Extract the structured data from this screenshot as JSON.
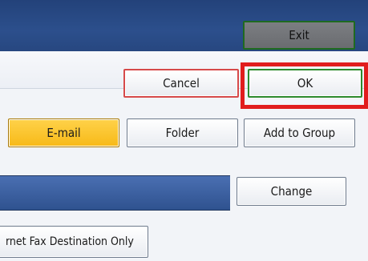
{
  "header": {
    "exit_label": "Exit"
  },
  "actions": {
    "cancel_label": "Cancel",
    "ok_label": "OK"
  },
  "destination_types": {
    "email_label": "E-mail",
    "folder_label": "Folder",
    "add_to_group_label": "Add to Group"
  },
  "destination": {
    "change_label": "Change"
  },
  "options": {
    "internet_fax_only_label": "rnet Fax Destination Only"
  },
  "colors": {
    "header_blue": "#2c4f8c",
    "selected_yellow": "#f7b917",
    "highlight_red": "#e11d1d"
  }
}
